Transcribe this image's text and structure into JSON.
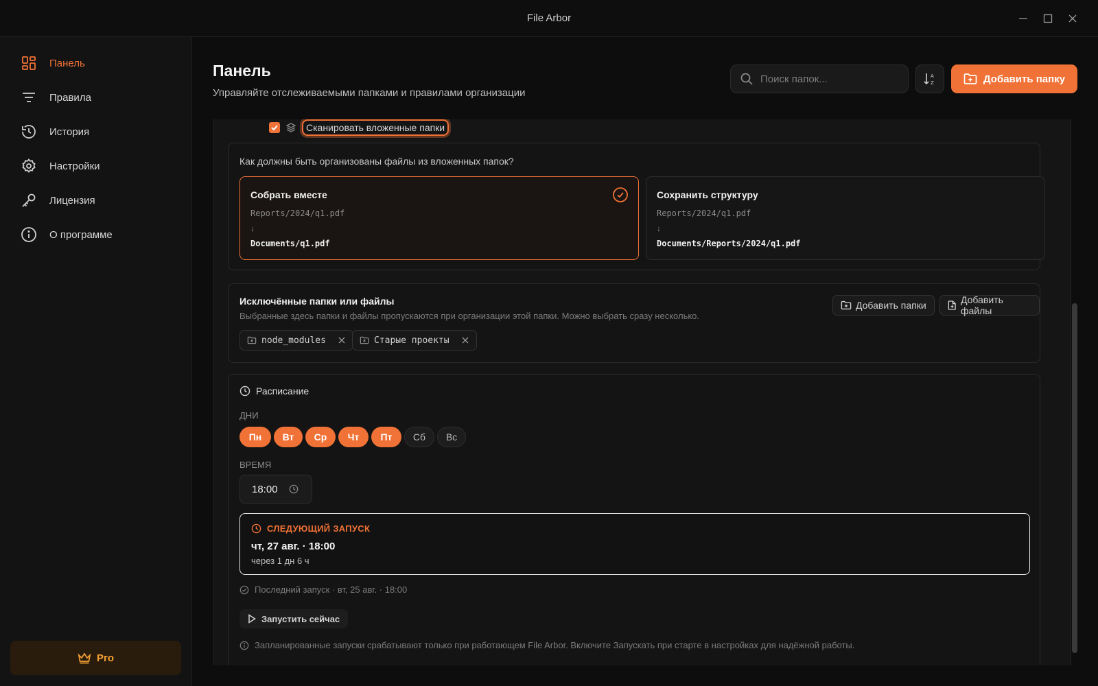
{
  "window": {
    "title": "File Arbor"
  },
  "colors": {
    "accent": "#f07236",
    "pro": "#f5a033",
    "background": "#0d0d0d"
  },
  "sidebar": {
    "items": [
      {
        "label": "Панель",
        "icon": "dashboard-icon",
        "active": true
      },
      {
        "label": "Правила",
        "icon": "filter-icon",
        "active": false
      },
      {
        "label": "История",
        "icon": "history-icon",
        "active": false
      },
      {
        "label": "Настройки",
        "icon": "gear-icon",
        "active": false
      },
      {
        "label": "Лицензия",
        "icon": "key-icon",
        "active": false
      },
      {
        "label": "О программе",
        "icon": "info-icon",
        "active": false
      }
    ],
    "pro_label": "Pro"
  },
  "header": {
    "title": "Панель",
    "subtitle": "Управляйте отслеживаемыми папками и правилами организации",
    "search_placeholder": "Поиск папок...",
    "add_folder_label": "Добавить папку"
  },
  "scan": {
    "checked": true,
    "label": "Сканировать вложенные папки"
  },
  "organize": {
    "question": "Как должны быть организованы файлы из вложенных папок?",
    "options": [
      {
        "title": "Собрать вместе",
        "from": "Reports/2024/q1.pdf",
        "arrow": "↓",
        "to": "Documents/q1.pdf",
        "selected": true
      },
      {
        "title": "Сохранить структуру",
        "from": "Reports/2024/q1.pdf",
        "arrow": "↓",
        "to": "Documents/Reports/2024/q1.pdf",
        "selected": false
      }
    ]
  },
  "excluded": {
    "title": "Исключённые папки или файлы",
    "description": "Выбранные здесь папки и файлы пропускаются при организации этой папки. Можно выбрать сразу несколько.",
    "add_folders_label": "Добавить папки",
    "add_files_label": "Добавить файлы",
    "items": [
      "node_modules",
      "Старые проекты"
    ]
  },
  "schedule": {
    "title": "Расписание",
    "days_label": "ДНИ",
    "days": [
      {
        "label": "Пн",
        "on": true
      },
      {
        "label": "Вт",
        "on": true
      },
      {
        "label": "Ср",
        "on": true
      },
      {
        "label": "Чт",
        "on": true
      },
      {
        "label": "Пт",
        "on": true
      },
      {
        "label": "Сб",
        "on": false
      },
      {
        "label": "Вс",
        "on": false
      }
    ],
    "time_label": "ВРЕМЯ",
    "time": "18:00",
    "next_run_label": "СЛЕДУЮЩИЙ ЗАПУСК",
    "next_run_date": "чт, 27 авг. · 18:00",
    "next_run_in": "через 1 дн 6 ч",
    "last_run": "Последний запуск · вт, 25 авг. · 18:00",
    "run_now_label": "Запустить сейчас",
    "note": "Запланированные запуски срабатывают только при работающем File Arbor. Включите Запускать при старте в настройках для надёжной работы."
  }
}
